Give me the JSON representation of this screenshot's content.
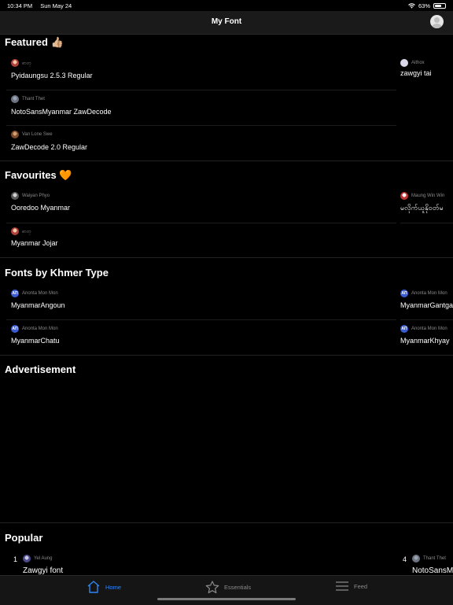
{
  "status": {
    "time": "10:34 PM",
    "date": "Sun May 24",
    "battery": "63%"
  },
  "nav": {
    "title": "My Font"
  },
  "featured": {
    "title": "Featured 👍🏼",
    "items": [
      {
        "author": "ဓာတ္",
        "font": "Pyidaungsu 2.5.3 Regular"
      },
      {
        "author": "Thant Thet",
        "font": "NotoSansMyanmar ZawDecode"
      },
      {
        "author": "Van Lone Swe",
        "font": "ZawDecode 2.0 Regular"
      },
      {
        "author": "Aithox",
        "font": "zawgyi tai"
      }
    ]
  },
  "favourites": {
    "title": "Favourites 🧡",
    "items": [
      {
        "author": "Waiyan Phyo",
        "font": "Ooredoo Myanmar"
      },
      {
        "author": "ဓာတ္",
        "font": "Myanmar Jojar"
      },
      {
        "author": "Maung Win Win",
        "font": "မလိုက်ယူနိုဝတ်မ"
      }
    ]
  },
  "khmer": {
    "title": "Fonts by Khmer Type",
    "logo_text": "AΠ",
    "items": [
      {
        "author": "Anonta Mon Mon",
        "font": "MyanmarAngoun"
      },
      {
        "author": "Anonta Mon Mon",
        "font": "MyanmarChatu"
      },
      {
        "author": "Anonta Mon Mon",
        "font": "MyanmarGantga"
      },
      {
        "author": "Anonta Mon Mon",
        "font": "MyanmarKhyay"
      }
    ]
  },
  "advertisement": {
    "title": "Advertisement"
  },
  "popular": {
    "title": "Popular",
    "items": [
      {
        "rank": "1",
        "author": "Yel Aung",
        "font": "Zawgyi font"
      },
      {
        "rank": "4",
        "author": "Thant Thet",
        "font": "NotoSansMy"
      }
    ]
  },
  "tabs": [
    {
      "label": "Home",
      "icon": "home-icon",
      "active": true
    },
    {
      "label": "Essentials",
      "icon": "star-icon",
      "active": false
    },
    {
      "label": "Feed",
      "icon": "list-icon",
      "active": false
    }
  ],
  "colors": {
    "accent": "#2f86f6",
    "background": "#000000",
    "muted": "#8a8a8a"
  }
}
